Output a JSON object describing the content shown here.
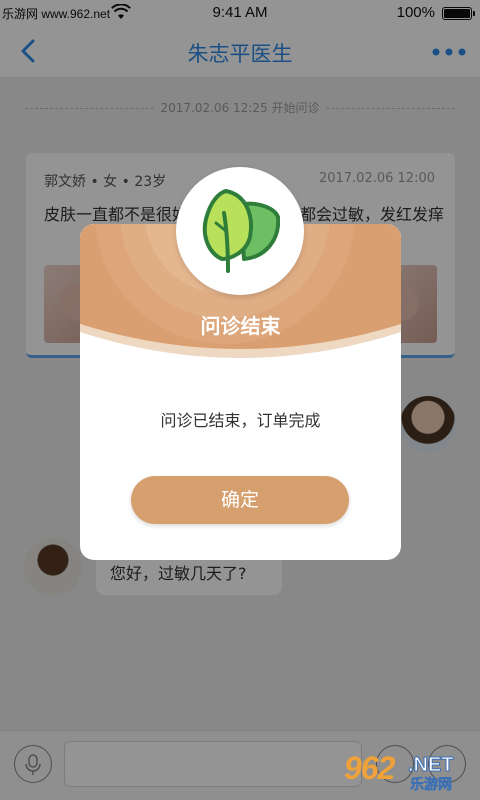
{
  "status_bar": {
    "source_label": "乐游网 www.962.net",
    "time": "9:41 AM",
    "battery": "100%"
  },
  "nav": {
    "title": "朱志平医生"
  },
  "chat": {
    "session_start": "2017.02.06  12:25  开始问诊",
    "consult_card": {
      "patient": "郭文娇 • 女 • 23岁",
      "date": "2017.02.06  12:00",
      "description": "皮肤一直都不是很好，每年三四月份都会过敏，发红发痒"
    },
    "doctor_message": "您好，过敏几天了?"
  },
  "modal": {
    "title": "问诊结束",
    "message": "问诊已结束，订单完成",
    "confirm_label": "确定"
  },
  "watermark": {
    "number": "962",
    "suffix": ".NET",
    "site_name": "乐游网"
  },
  "colors": {
    "accent_blue": "#2e8ae6",
    "modal_orange": "#d69f6e",
    "logo_green": "#9dd34a"
  }
}
